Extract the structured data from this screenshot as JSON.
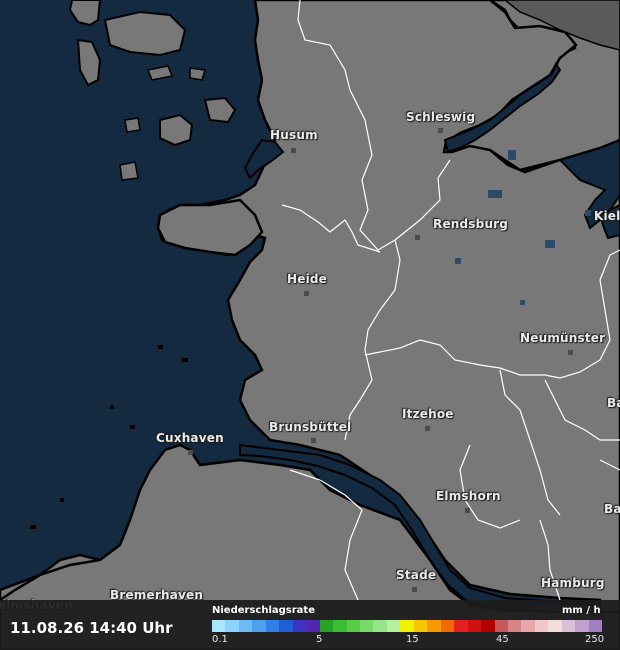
{
  "timestamp": "11.08.26 14:40 Uhr",
  "legend": {
    "title": "Niederschlagsrate",
    "unit": "mm / h",
    "ticks": [
      "0.1",
      "5",
      "15",
      "45",
      "250"
    ],
    "colors": [
      "#a9e7ff",
      "#8ed3ff",
      "#6dbaf5",
      "#4f9ff0",
      "#2f7fe6",
      "#1f5fd6",
      "#3a33c4",
      "#5226b0",
      "#26a326",
      "#3cbc32",
      "#59cd4a",
      "#7ad96a",
      "#95e487",
      "#b6ef9e",
      "#f0f000",
      "#f7c600",
      "#f79a00",
      "#f06a00",
      "#e62020",
      "#d11010",
      "#b50000",
      "#c4585a",
      "#d68486",
      "#e6a8aa",
      "#f0c8c8",
      "#f4dcdc",
      "#d8c0d8",
      "#c0a0cc",
      "#a080c0"
    ]
  },
  "map_colors": {
    "land": "#787878",
    "sea": "#132a41",
    "border": "#ffffff",
    "coast": "#000000"
  },
  "cities": [
    {
      "name": "Husum"
    },
    {
      "name": "Schleswig"
    },
    {
      "name": "Rendsburg"
    },
    {
      "name": "Heide"
    },
    {
      "name": "Neumünster"
    },
    {
      "name": "Itzehoe"
    },
    {
      "name": "Brunsbüttel"
    },
    {
      "name": "Cuxhaven"
    },
    {
      "name": "Elmshorn"
    },
    {
      "name": "Stade"
    },
    {
      "name": "Hamburg"
    },
    {
      "name": "Bremerhaven"
    },
    {
      "name": "Kiel"
    },
    {
      "name": "Ba"
    },
    {
      "name": "Ba"
    },
    {
      "name": "elmshaven"
    }
  ]
}
